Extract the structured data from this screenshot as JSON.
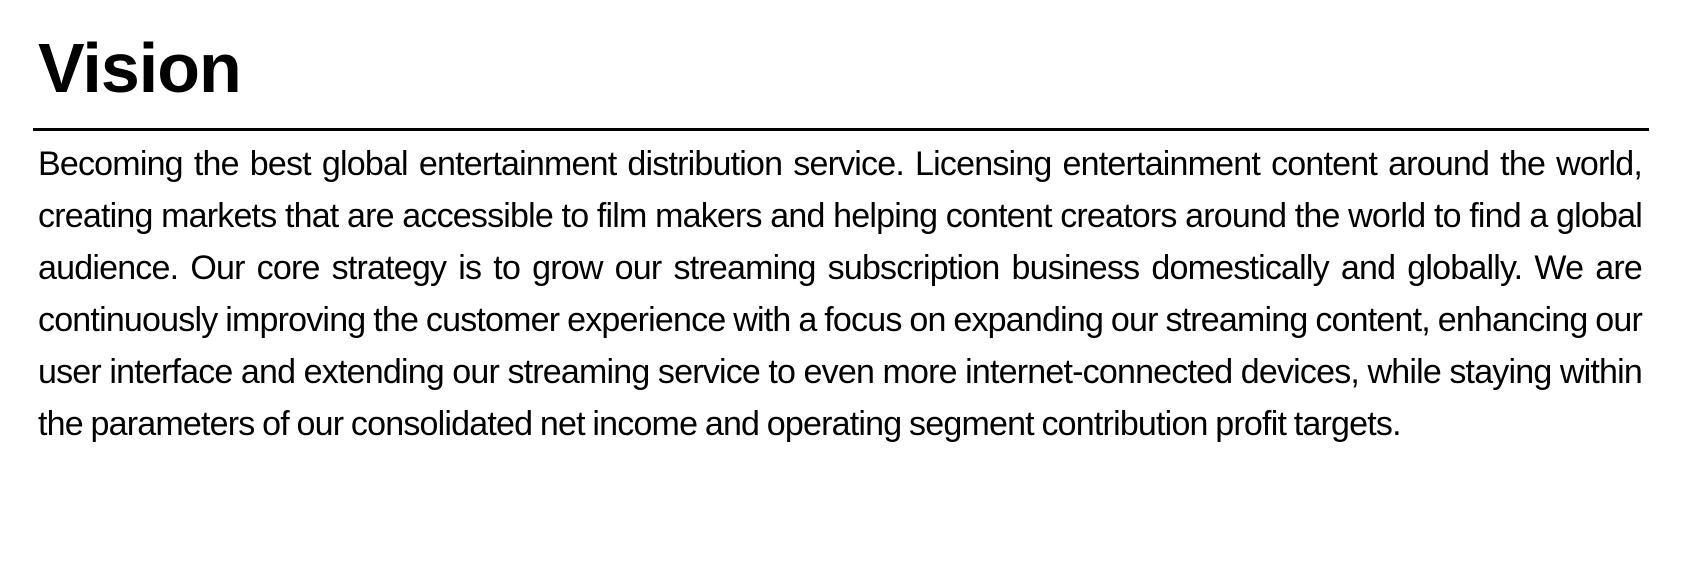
{
  "section": {
    "title": "Vision",
    "body": "Becoming the best global entertainment distribution service. Licensing entertainment content around the world, creating markets that are accessible to film makers and helping content creators around the world to find a global audience. Our core strategy is to grow our streaming subscription business domestically and globally. We are continuously improving the customer experience with a focus on expanding our streaming content, enhancing our user interface and extending our streaming service to even more internet-connected devices, while staying within the parameters of our consolidated net income and operating segment contribution profit targets."
  }
}
